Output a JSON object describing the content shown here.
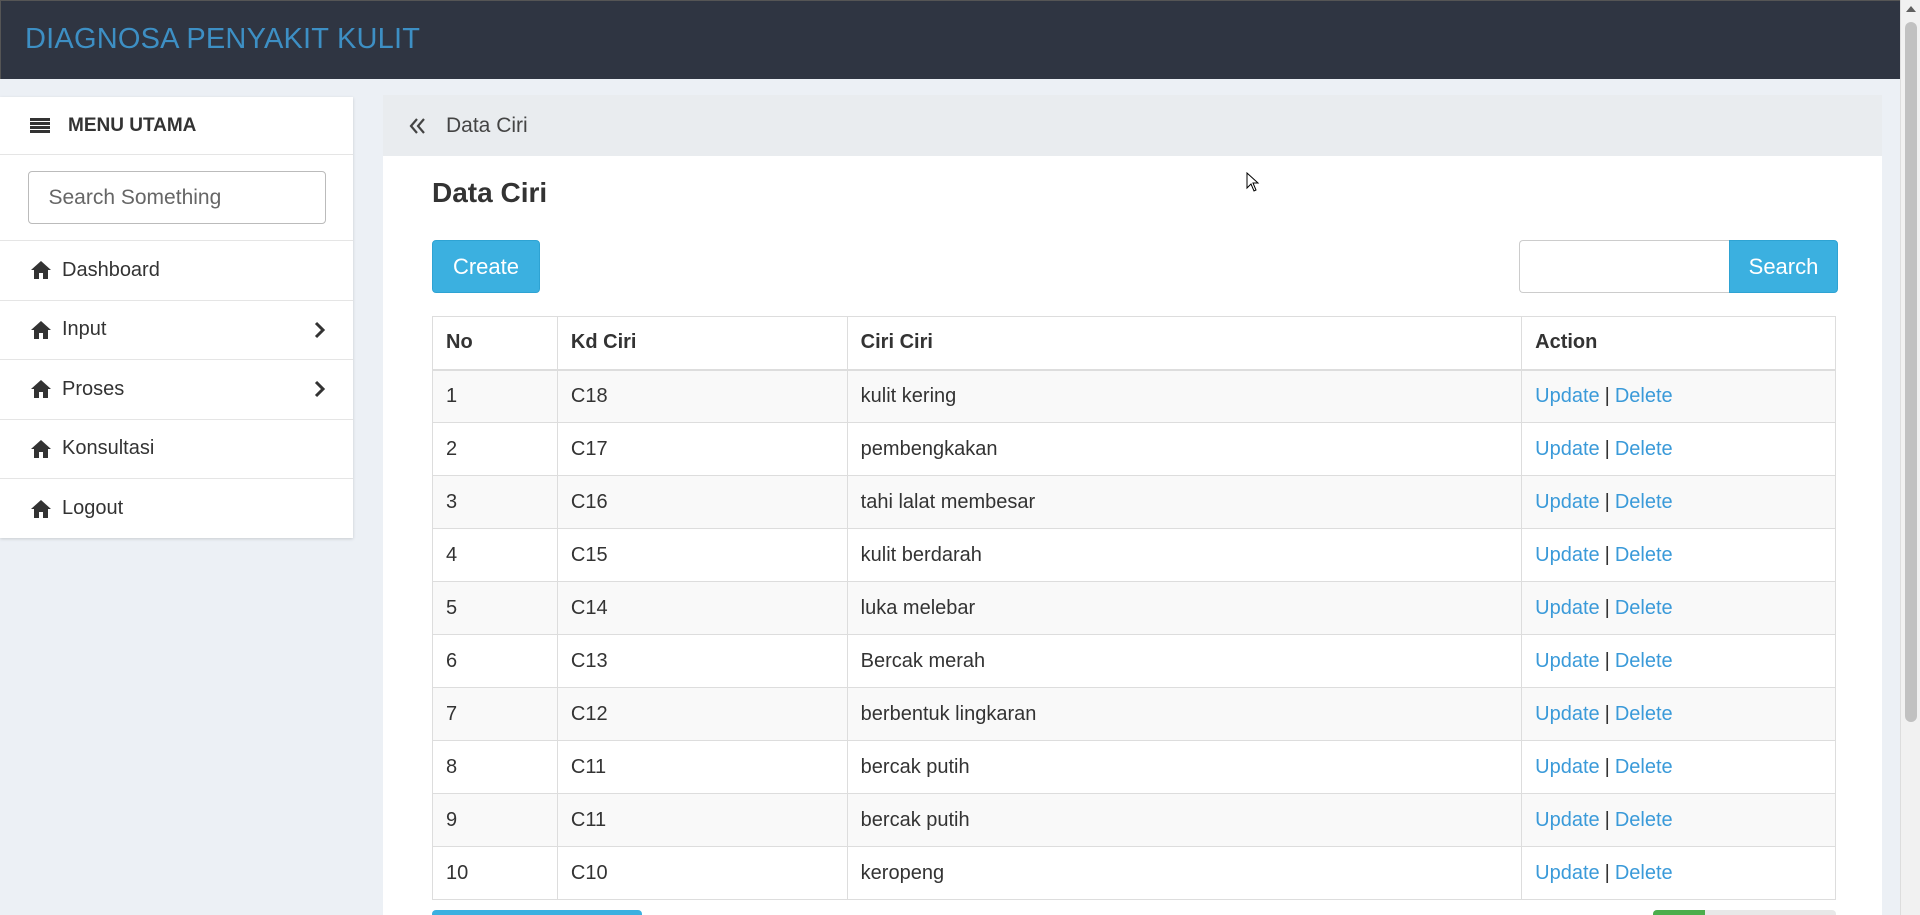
{
  "app": {
    "title": "DIAGNOSA PENYAKIT KULIT"
  },
  "sidebar": {
    "header": "MENU UTAMA",
    "search_placeholder": "Search Something",
    "items": [
      {
        "label": "Dashboard",
        "icon": "home-icon",
        "submenu": false
      },
      {
        "label": "Input",
        "icon": "home-icon",
        "submenu": true
      },
      {
        "label": "Proses",
        "icon": "home-icon",
        "submenu": true
      },
      {
        "label": "Konsultasi",
        "icon": "home-icon",
        "submenu": false
      },
      {
        "label": "Logout",
        "icon": "home-icon",
        "submenu": false
      }
    ]
  },
  "breadcrumb": {
    "label": "Data Ciri"
  },
  "page": {
    "title": "Data Ciri",
    "create_label": "Create",
    "search_label": "Search",
    "search_value": ""
  },
  "table": {
    "headers": [
      "No",
      "Kd Ciri",
      "Ciri Ciri",
      "Action"
    ],
    "update_label": "Update",
    "separator": "|",
    "delete_label": "Delete",
    "rows": [
      {
        "no": "1",
        "kd": "C18",
        "ciri": "kulit kering"
      },
      {
        "no": "2",
        "kd": "C17",
        "ciri": "pembengkakan"
      },
      {
        "no": "3",
        "kd": "C16",
        "ciri": "tahi lalat membesar"
      },
      {
        "no": "4",
        "kd": "C15",
        "ciri": "kulit berdarah"
      },
      {
        "no": "5",
        "kd": "C14",
        "ciri": "luka melebar"
      },
      {
        "no": "6",
        "kd": "C13",
        "ciri": "Bercak merah"
      },
      {
        "no": "7",
        "kd": "C12",
        "ciri": "berbentuk lingkaran"
      },
      {
        "no": "8",
        "kd": "C11",
        "ciri": "bercak putih"
      },
      {
        "no": "9",
        "kd": "C11",
        "ciri": "bercak putih"
      },
      {
        "no": "10",
        "kd": "C10",
        "ciri": "keropeng"
      }
    ]
  },
  "colors": {
    "navbar": "#2f3542",
    "brand": "#3d8fc4",
    "primary_button": "#3bb0e0",
    "link": "#3a9ad9",
    "background": "#ecf0f5"
  }
}
